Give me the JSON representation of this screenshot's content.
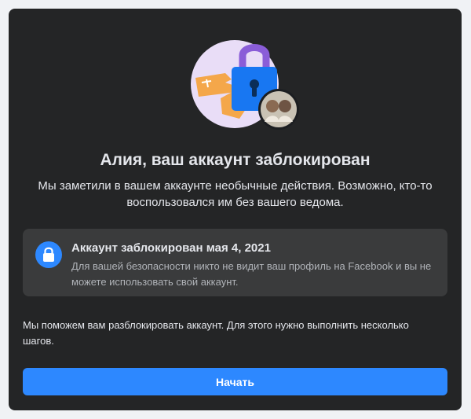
{
  "header": {
    "title": "Алия, ваш аккаунт заблокирован",
    "subtitle": "Мы заметили в вашем аккаунте необычные действия. Возможно, кто-то воспользовался им без вашего ведома."
  },
  "notice": {
    "icon": "lock-icon",
    "title": "Аккаунт заблокирован мая 4, 2021",
    "body": "Для вашей безопасности никто не видит ваш профиль на Facebook и вы не можете использовать свой аккаунт."
  },
  "help": {
    "text": "Мы поможем вам разблокировать аккаунт. Для этого нужно выполнить несколько шагов."
  },
  "actions": {
    "start_label": "Начать"
  },
  "colors": {
    "background": "#242526",
    "notice_background": "#3a3b3c",
    "accent": "#2d88ff",
    "text_primary": "#e4e6eb",
    "text_secondary": "#b0b3b8"
  }
}
